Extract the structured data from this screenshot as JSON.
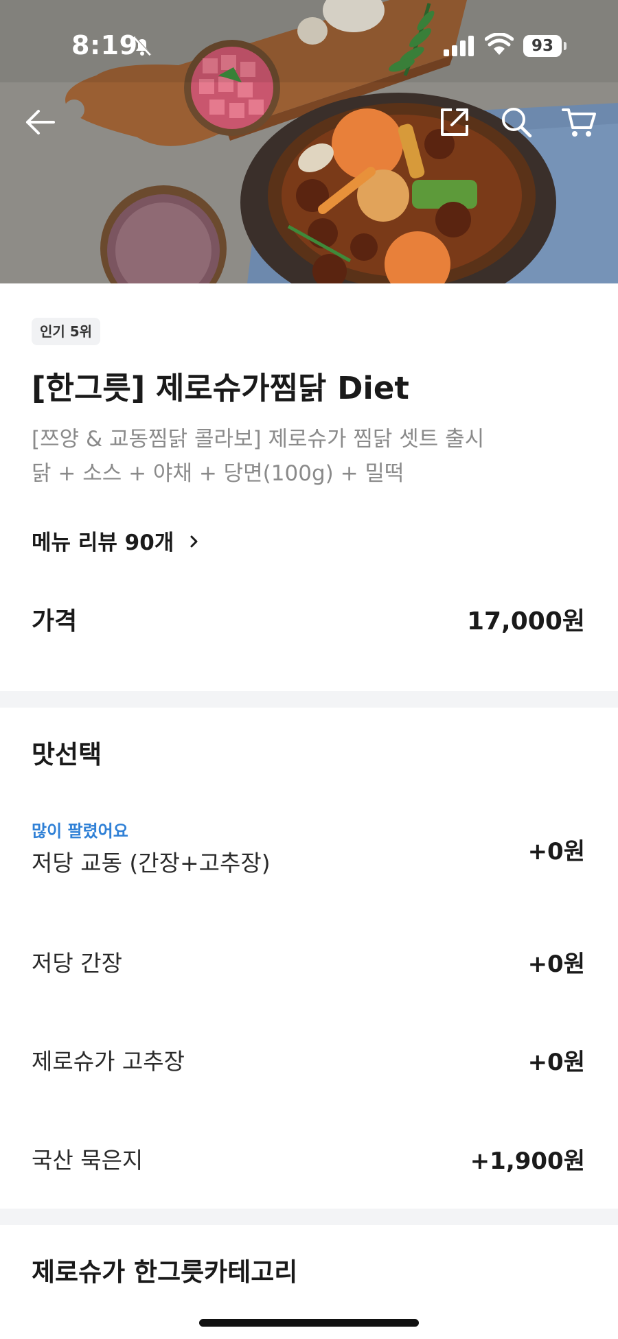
{
  "status_bar": {
    "time": "8:19",
    "battery": "93"
  },
  "nav": {
    "back_icon": "back-arrow-icon",
    "share_icon": "share-icon",
    "search_icon": "search-icon",
    "cart_icon": "cart-icon"
  },
  "product": {
    "badge": "인기 5위",
    "title": "[한그릇] 제로슈가찜닭 Diet",
    "description_line1": "[쯔양 & 교동찜닭 콜라보] 제로슈가 찜닭 셋트 출시",
    "description_line2": "닭 + 소스 + 야채 + 당면(100g) + 밀떡",
    "review_link": "메뉴 리뷰 90개",
    "price_label": "가격",
    "price": "17,000원"
  },
  "taste": {
    "title": "맛선택",
    "options": [
      {
        "tag": "많이 팔렸어요",
        "name": "저당 교동 (간장+고추장)",
        "price": "+0원"
      },
      {
        "name": "저당 간장",
        "price": "+0원"
      },
      {
        "name": "제로슈가 고추장",
        "price": "+0원"
      },
      {
        "name": "국산 묵은지",
        "price": "+1,900원"
      }
    ]
  },
  "category": {
    "title": "제로슈가 한그릇카테고리"
  },
  "colors": {
    "accent_blue": "#2f80d6",
    "divider": "#f3f4f6",
    "muted_text": "#8a8a8a"
  }
}
